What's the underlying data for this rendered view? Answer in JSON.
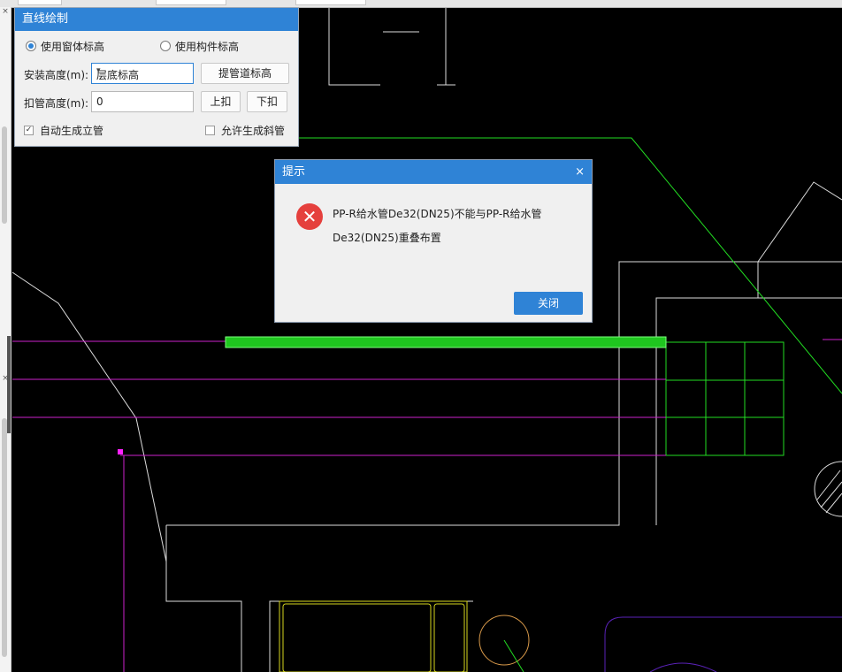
{
  "panel": {
    "title": "直线绘制",
    "radio_window": "使用窗体标高",
    "radio_component": "使用构件标高",
    "install_height_label": "安装高度(m):",
    "install_height_value": "层底标高",
    "raise_button": "提管道标高",
    "deduct_label": "扣管高度(m):",
    "deduct_value": "0",
    "up_button": "上扣",
    "down_button": "下扣",
    "auto_riser_label": "自动生成立管",
    "allow_slope_label": "允许生成斜管"
  },
  "dialog": {
    "title": "提示",
    "close_glyph": "×",
    "message_line1": "PP-R给水管De32(DN25)不能与PP-R给水管",
    "message_line2": "De32(DN25)重叠布置",
    "close_button": "关闭",
    "error_glyph": "✕"
  },
  "left_strip": {
    "close_glyph": "×"
  },
  "colors": {
    "accent": "#2f83d6",
    "error": "#e5403d",
    "cad_background": "#000000",
    "pipe_magenta": "#cc22cc",
    "pipe_green": "#22dd22",
    "outline_white": "#dcdcdc",
    "fixture_yellow": "#d6d61e",
    "fixture_orange": "#d99a4a",
    "fixture_purple": "#5a22b8"
  }
}
